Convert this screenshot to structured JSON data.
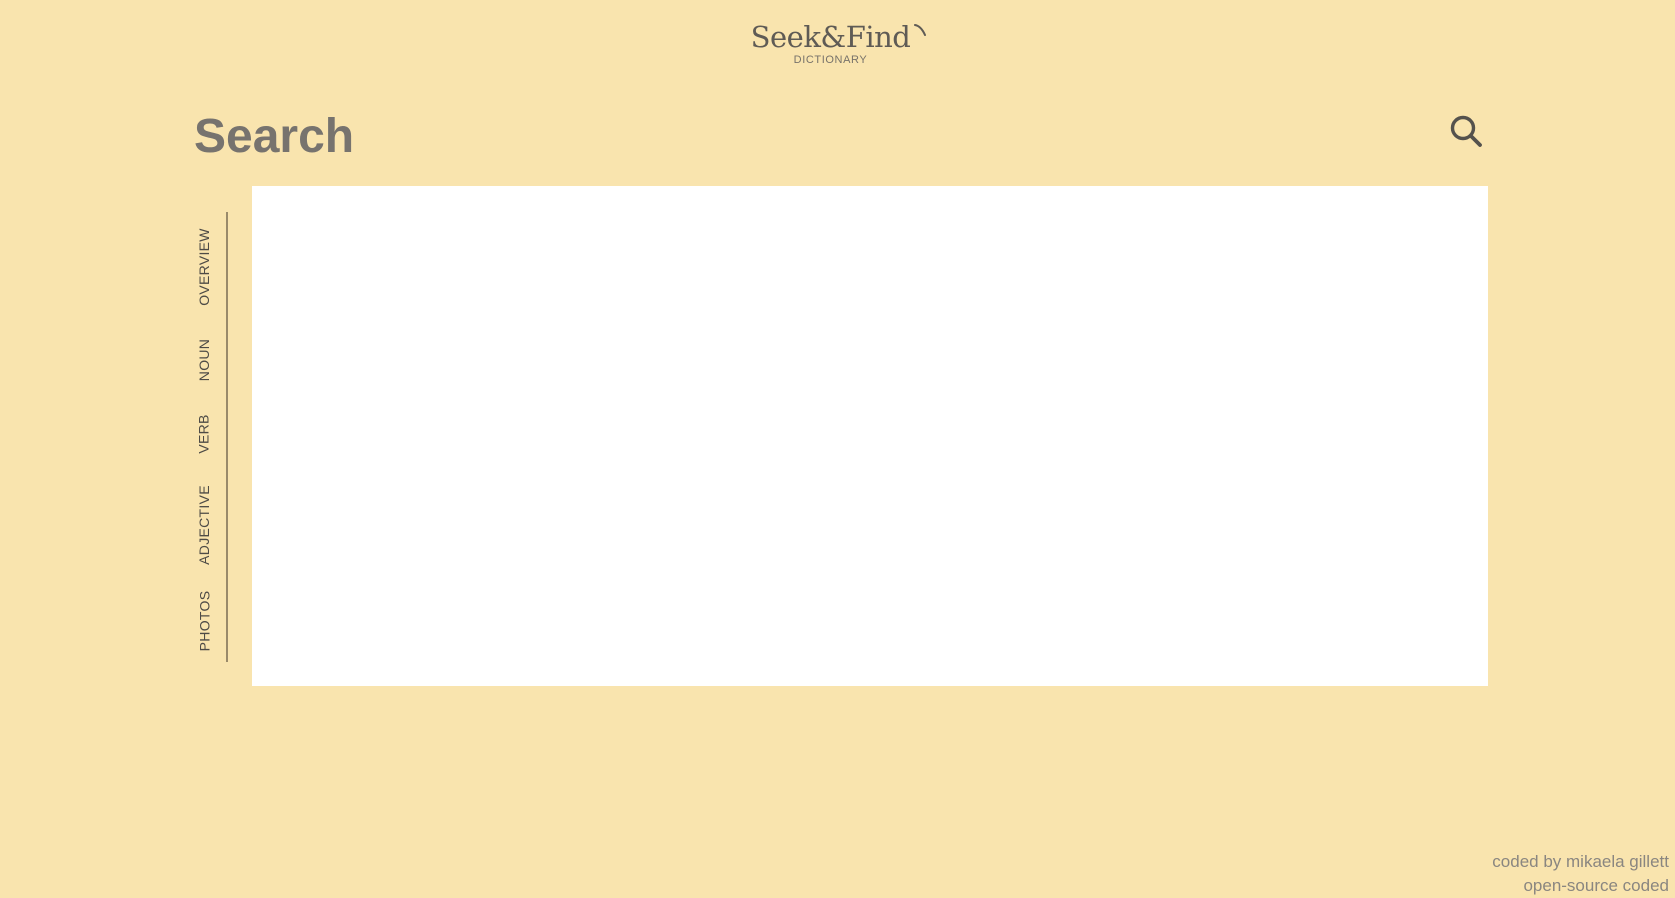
{
  "logo": {
    "title": "Seek&Find",
    "subtitle": "DICTIONARY"
  },
  "search": {
    "placeholder": "Search",
    "icon": "search-icon"
  },
  "tabs": [
    {
      "label": "OVERVIEW"
    },
    {
      "label": "NOUN"
    },
    {
      "label": "VERB"
    },
    {
      "label": "ADJECTIVE"
    },
    {
      "label": "PHOTOS"
    }
  ],
  "footer": {
    "credit": "coded by mikaela gillett",
    "source": "open-source coded"
  },
  "colors": {
    "background": "#f9e4ae",
    "panel": "#ffffff",
    "text": "#5f5b55",
    "tab_line": "#9a8a6a"
  }
}
